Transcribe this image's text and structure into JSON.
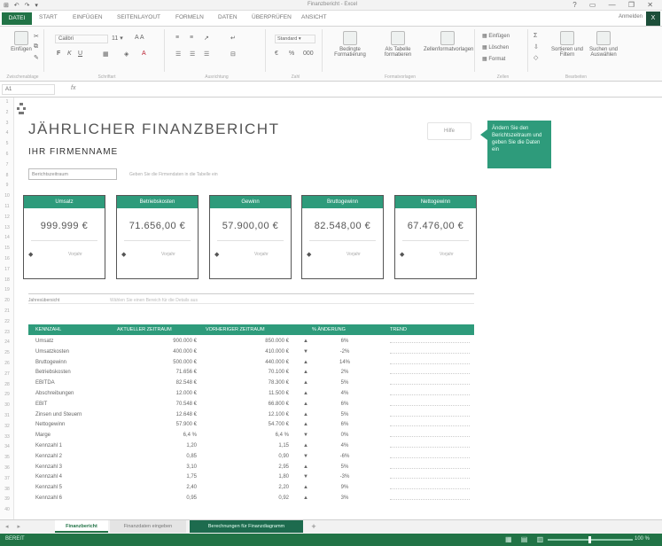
{
  "titlebar": {
    "qat": "⊞ ↶ ↷ ▾",
    "title": "Finanzbericht - Excel",
    "controls": "?  ▭  —  ❐  ✕"
  },
  "tabs": [
    "DATEI",
    "START",
    "EINFÜGEN",
    "SEITENLAYOUT",
    "FORMELN",
    "DATEN",
    "ÜBERPRÜFEN",
    "ANSICHT"
  ],
  "user": {
    "name": "Anmelden",
    "badge": "X"
  },
  "ribbon": {
    "paste": "Einfügen",
    "font": "Calibri",
    "groups": [
      "Zwischenablage",
      "Schriftart",
      "Ausrichtung",
      "Zahl",
      "Formatvorlagen",
      "Zellen",
      "Bearbeiten"
    ],
    "styles": [
      "Bedingte Formatierung",
      "Als Tabelle formatieren",
      "Zellenformatvorlagen"
    ],
    "cells": [
      "Einfügen",
      "Löschen",
      "Format"
    ],
    "edit": [
      "Sortieren und Filtern",
      "Suchen und Auswählen"
    ]
  },
  "formula": {
    "namebox": "A1",
    "fx": "fx"
  },
  "sheet": {
    "title": "JÄHRLICHER FINANZBERICHT",
    "subtitle": "IHR FIRMENNAME",
    "report_box": "Berichtszeitraum",
    "report_note": "Geben Sie die Firmendaten in die Tabelle ein",
    "small_button": "Hilfe",
    "tip": "Ändern Sie den Berichtszeitraum und geben Sie die Daten ein",
    "section_label": "Jahresübersicht",
    "section_note": "Wählen Sie einen Bereich für die Details aus"
  },
  "kpis": [
    {
      "label": "Umsatz",
      "value": "999.999 €",
      "foot": "Vorjahr"
    },
    {
      "label": "Betriebskosten",
      "value": "71.656,00 €",
      "foot": "Vorjahr"
    },
    {
      "label": "Gewinn",
      "value": "57.900,00 €",
      "foot": "Vorjahr"
    },
    {
      "label": "Bruttogewinn",
      "value": "82.548,00 €",
      "foot": "Vorjahr"
    },
    {
      "label": "Nettogewinn",
      "value": "67.476,00 €",
      "foot": "Vorjahr"
    }
  ],
  "table": {
    "headers": [
      "KENNZAHL",
      "AKTUELLER ZEITRAUM",
      "VORHERIGER ZEITRAUM",
      "% ÄNDERUNG",
      "TREND"
    ],
    "rows": [
      [
        "Umsatz",
        "900.000 €",
        "850.000 €",
        "▲",
        "6%"
      ],
      [
        "Umsatzkosten",
        "400.000 €",
        "410.000 €",
        "▼",
        "-2%"
      ],
      [
        "Bruttogewinn",
        "500.000 €",
        "440.000 €",
        "▲",
        "14%"
      ],
      [
        "Betriebskosten",
        "71.656 €",
        "70.100 €",
        "▲",
        "2%"
      ],
      [
        "EBITDA",
        "82.548 €",
        "78.300 €",
        "▲",
        "5%"
      ],
      [
        "Abschreibungen",
        "12.000 €",
        "11.500 €",
        "▲",
        "4%"
      ],
      [
        "EBIT",
        "70.548 €",
        "66.800 €",
        "▲",
        "6%"
      ],
      [
        "Zinsen und Steuern",
        "12.648 €",
        "12.100 €",
        "▲",
        "5%"
      ],
      [
        "Nettogewinn",
        "57.900 €",
        "54.700 €",
        "▲",
        "6%"
      ],
      [
        "Marge",
        "6,4 %",
        "6,4 %",
        "▼",
        "0%"
      ],
      [
        "Kennzahl 1",
        "1,20",
        "1,15",
        "▲",
        "4%"
      ],
      [
        "Kennzahl 2",
        "0,85",
        "0,90",
        "▼",
        "-6%"
      ],
      [
        "Kennzahl 3",
        "3,10",
        "2,95",
        "▲",
        "5%"
      ],
      [
        "Kennzahl 4",
        "1,75",
        "1,80",
        "▼",
        "-3%"
      ],
      [
        "Kennzahl 5",
        "2,40",
        "2,20",
        "▲",
        "9%"
      ],
      [
        "Kennzahl 6",
        "0,95",
        "0,92",
        "▲",
        "3%"
      ]
    ]
  },
  "sheet_tabs": [
    "Finanzbericht",
    "Finanzdaten eingeben",
    "Berechnungen für Finanzdiagramm",
    "+"
  ],
  "status": {
    "ready": "BEREIT",
    "views": "▦ ▤ ▥",
    "zoom": "100 %"
  }
}
